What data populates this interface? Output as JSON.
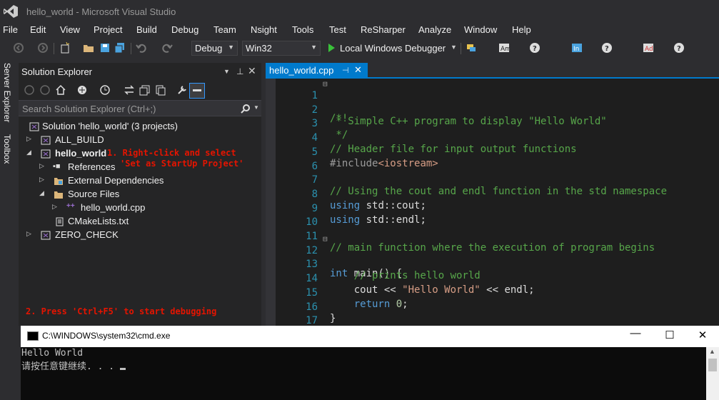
{
  "window": {
    "title": "hello_world - Microsoft Visual Studio"
  },
  "menu": [
    "File",
    "Edit",
    "View",
    "Project",
    "Build",
    "Debug",
    "Team",
    "Nsight",
    "Tools",
    "Test",
    "ReSharper",
    "Analyze",
    "Window",
    "Help"
  ],
  "toolbar": {
    "config": "Debug",
    "platform": "Win32",
    "run_label": "Local Windows Debugger"
  },
  "side_tabs": [
    "Server Explorer",
    "Toolbox"
  ],
  "solution_explorer": {
    "title": "Solution Explorer",
    "search_placeholder": "Search Solution Explorer (Ctrl+;)",
    "items": [
      {
        "label": "Solution 'hello_world' (3 projects)",
        "icon": "solution-icon"
      },
      {
        "label": "ALL_BUILD",
        "icon": "project-icon"
      },
      {
        "label": "hello_world",
        "icon": "project-icon"
      },
      {
        "label": "References",
        "icon": "references-icon"
      },
      {
        "label": "External Dependencies",
        "icon": "folder-icon"
      },
      {
        "label": "Source Files",
        "icon": "folder-icon"
      },
      {
        "label": "hello_world.cpp",
        "icon": "cpp-file-icon"
      },
      {
        "label": "CMakeLists.txt",
        "icon": "text-file-icon"
      },
      {
        "label": "ZERO_CHECK",
        "icon": "project-icon"
      }
    ],
    "note1_line1": "1. Right-click and select",
    "note1_line2": "'Set as StartUp Project'",
    "note2": "2. Press 'Ctrl+F5' to start debugging"
  },
  "editor": {
    "tab": "hello_world.cpp",
    "line_numbers": [
      "1",
      "2",
      "3",
      "4",
      "5",
      "6",
      "7",
      "8",
      "9",
      "10",
      "11",
      "12",
      "13",
      "14",
      "15",
      "16",
      "17"
    ]
  },
  "cmd": {
    "title": "C:\\WINDOWS\\system32\\cmd.exe",
    "line1": "Hello World",
    "line2": "请按任意键继续. . . "
  },
  "colors": {
    "accent": "#007acc",
    "comment": "#57a64a",
    "keyword": "#569cd6",
    "string": "#d69d85",
    "annotation": "#e51400"
  }
}
